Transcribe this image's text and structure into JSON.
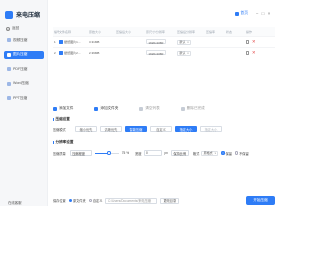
{
  "app": {
    "name": "来电压缩",
    "back_label": "返回",
    "bottom_left_label": "在线客服"
  },
  "sidebar": {
    "items": [
      {
        "label": "视频压缩",
        "active": false
      },
      {
        "label": "图片压缩",
        "active": true
      },
      {
        "label": "PDF压缩",
        "active": false
      },
      {
        "label": "Word压缩",
        "active": false
      },
      {
        "label": "PPT压缩",
        "active": false
      }
    ]
  },
  "titlebar": {
    "home_label": "首页",
    "controls": [
      "−",
      "□",
      "×"
    ]
  },
  "table": {
    "headers": [
      "编号",
      "文件名称",
      "原始大小",
      "压缩后大小",
      "原尺寸/分辨率",
      "压缩后分辨率",
      "压缩率",
      "状态",
      "操作"
    ],
    "rows": [
      {
        "index": "1",
        "name": "壁纸图片1....",
        "size": "3.31MB",
        "compressed_size": "",
        "resolution": "1920x1080",
        "target": "默认",
        "ratio": "",
        "status": ""
      },
      {
        "index": "2",
        "name": "壁纸图片2....",
        "size": "2.39MB",
        "compressed_size": "",
        "resolution": "1920x1080",
        "target": "默认",
        "ratio": "",
        "status": ""
      }
    ]
  },
  "actions": [
    {
      "label": "添加文件",
      "disabled": false
    },
    {
      "label": "添加文件夹",
      "disabled": false
    },
    {
      "label": "清空列表",
      "disabled": true
    },
    {
      "label": "删除已完成",
      "disabled": true
    }
  ],
  "compress": {
    "section_title": "压缩设置",
    "mode_label": "压缩模式",
    "modes": [
      {
        "label": "缩小优先",
        "active": false
      },
      {
        "label": "清晰优先",
        "active": false
      },
      {
        "label": "智能压缩",
        "active": true
      },
      {
        "label": "自定义",
        "active": false
      }
    ],
    "extra_modes": [
      {
        "label": "指定大小",
        "active": true
      },
      {
        "label": "指定大小",
        "active": false
      }
    ]
  },
  "output": {
    "section_title": "分辨率设置",
    "label": "压缩质量",
    "quality_text": "压缩程度",
    "quality_value": "75",
    "quality_fraction": 0.6,
    "unit_label": "%",
    "width_label": "宽度",
    "width_value": "0",
    "height_label": "px",
    "keep_ratio_label": "保持比例",
    "format_label": "格式",
    "format_value": "原格式",
    "radio_1": "保留",
    "radio_2": "不保留"
  },
  "bottom": {
    "label": "保存位置",
    "radio_same": "原文件夹",
    "radio_custom": "自定义",
    "path": "C:/Users/Documents/来电压缩",
    "change_button": "更改目录",
    "start_button": "开始压缩"
  }
}
